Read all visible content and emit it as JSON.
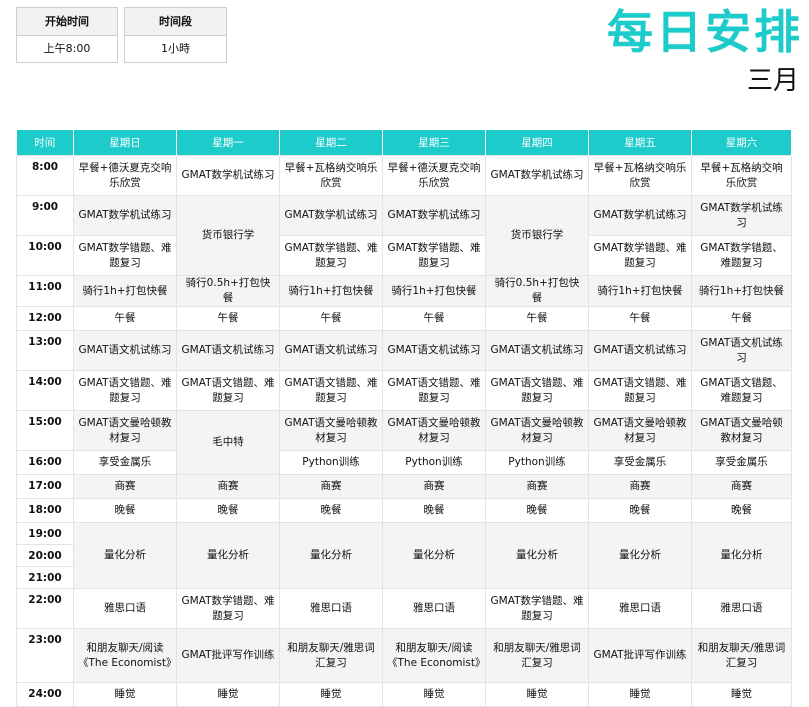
{
  "settings": {
    "start_label": "开始时间",
    "start_value": "上午8:00",
    "interval_label": "时间段",
    "interval_value": "1小時"
  },
  "title": "每日安排",
  "month": "三月",
  "header": [
    "时间",
    "星期日",
    "星期一",
    "星期二",
    "星期三",
    "星期四",
    "星期五",
    "星期六"
  ],
  "rows": {
    "r0800": [
      "8:00",
      "早餐+德沃夏克交响乐欣赏",
      "GMAT数学机试练习",
      "早餐+瓦格纳交响乐欣赏",
      "早餐+德沃夏克交响乐欣赏",
      "GMAT数学机试练习",
      "早餐+瓦格纳交响乐欣赏",
      "早餐+瓦格纳交响乐欣赏"
    ],
    "r0900": [
      "9:00",
      "GMAT数学机试练习",
      "货币银行学",
      "GMAT数学机试练习",
      "GMAT数学机试练习",
      "货币银行学",
      "GMAT数学机试练习",
      "GMAT数学机试练习"
    ],
    "r1000": [
      "10:00",
      "GMAT数学错题、难题复习",
      "GMAT数学错题、难题复习",
      "GMAT数学错题、难题复习",
      "GMAT数学错题、难题复习",
      "GMAT数学错题、难题复习"
    ],
    "r1100": [
      "11:00",
      "骑行1h+打包快餐",
      "骑行0.5h+打包快餐",
      "骑行1h+打包快餐",
      "骑行1h+打包快餐",
      "骑行0.5h+打包快餐",
      "骑行1h+打包快餐",
      "骑行1h+打包快餐"
    ],
    "r1200": [
      "12:00",
      "午餐",
      "午餐",
      "午餐",
      "午餐",
      "午餐",
      "午餐",
      "午餐"
    ],
    "r1300": [
      "13:00",
      "GMAT语文机试练习",
      "GMAT语文机试练习",
      "GMAT语文机试练习",
      "GMAT语文机试练习",
      "GMAT语文机试练习",
      "GMAT语文机试练习",
      "GMAT语文机试练习"
    ],
    "r1400": [
      "14:00",
      "GMAT语文错题、难题复习",
      "GMAT语文错题、难题复习",
      "GMAT语文错题、难题复习",
      "GMAT语文错题、难题复习",
      "GMAT语文错题、难题复习",
      "GMAT语文错题、难题复习",
      "GMAT语文错题、难题复习"
    ],
    "r1500": [
      "15:00",
      "GMAT语文曼哈顿教材复习",
      "毛中特",
      "GMAT语文曼哈顿教材复习",
      "GMAT语文曼哈顿教材复习",
      "GMAT语文曼哈顿教材复习",
      "GMAT语文曼哈顿教材复习",
      "GMAT语文曼哈顿教材复习"
    ],
    "r1600": [
      "16:00",
      "享受金属乐",
      "Python训练",
      "Python训练",
      "Python训练",
      "享受金属乐",
      "享受金属乐"
    ],
    "r1700": [
      "17:00",
      "商赛",
      "商赛",
      "商赛",
      "商赛",
      "商赛",
      "商赛",
      "商赛"
    ],
    "r1800": [
      "18:00",
      "晚餐",
      "晚餐",
      "晚餐",
      "晚餐",
      "晚餐",
      "晚餐",
      "晚餐"
    ],
    "r1900": [
      "19:00",
      "量化分析",
      "量化分析",
      "量化分析",
      "量化分析",
      "量化分析",
      "量化分析",
      "量化分析"
    ],
    "r2000": [
      "20:00"
    ],
    "r2100": [
      "21:00"
    ],
    "r2200": [
      "22:00",
      "雅思口语",
      "GMAT数学错题、难题复习",
      "雅思口语",
      "雅思口语",
      "GMAT数学错题、难题复习",
      "雅思口语",
      "雅思口语"
    ],
    "r2300": [
      "23:00",
      "和朋友聊天/阅读《The Economist》",
      "GMAT批评写作训练",
      "和朋友聊天/雅思词汇复习",
      "和朋友聊天/阅读《The Economist》",
      "和朋友聊天/雅思词汇复习",
      "GMAT批评写作训练",
      "和朋友聊天/雅思词汇复习"
    ],
    "r2400": [
      "24:00",
      "睡觉",
      "睡觉",
      "睡觉",
      "睡觉",
      "睡觉",
      "睡觉",
      "睡觉"
    ]
  }
}
